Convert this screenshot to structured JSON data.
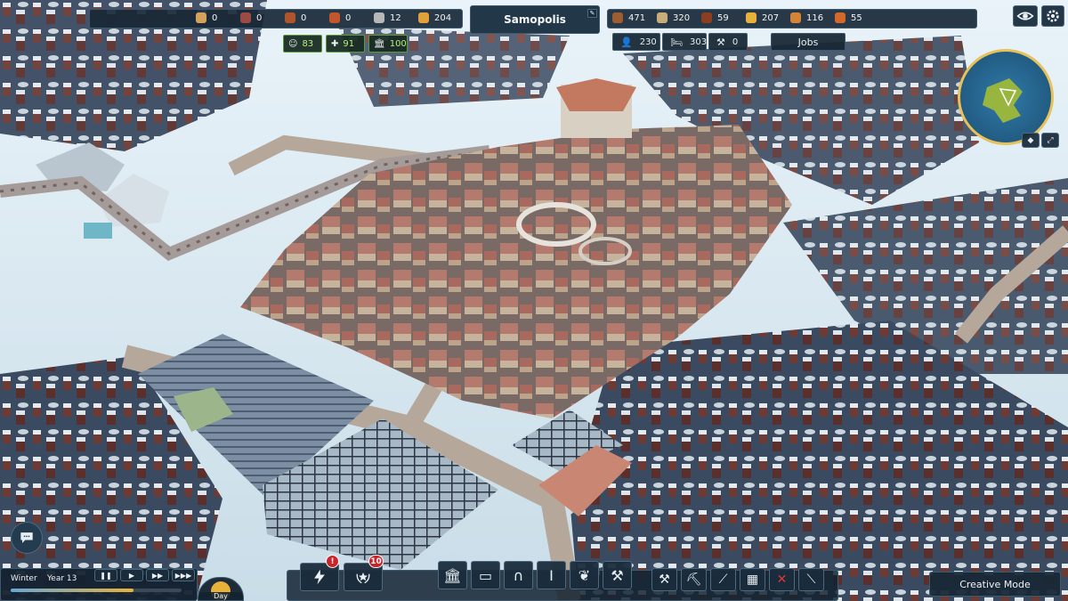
{
  "resources_left": [
    {
      "icon": "amphora-icon",
      "value": "0",
      "color": "#d4a25a"
    },
    {
      "icon": "grapes-icon",
      "value": "0",
      "color": "#9c4a44"
    },
    {
      "icon": "meat-icon",
      "value": "0",
      "color": "#b0542c"
    },
    {
      "icon": "fish-icon",
      "value": "0",
      "color": "#c2572e"
    },
    {
      "icon": "tool-icon",
      "value": "12",
      "color": "#b7b7b7"
    },
    {
      "icon": "bread-icon",
      "value": "204",
      "color": "#e2a03b"
    }
  ],
  "resources_right": [
    {
      "icon": "wood-icon",
      "value": "471",
      "color": "#9b5d31"
    },
    {
      "icon": "stone-icon",
      "value": "320",
      "color": "#c6ad7a"
    },
    {
      "icon": "clay-icon",
      "value": "59",
      "color": "#8a3e22"
    },
    {
      "icon": "gold-icon",
      "value": "207",
      "color": "#e7b23a"
    },
    {
      "icon": "fur-icon",
      "value": "116",
      "color": "#d48436"
    },
    {
      "icon": "wheat-icon",
      "value": "55",
      "color": "#d2692a"
    }
  ],
  "city": {
    "name": "Samopolis",
    "rename_icon": "edit-icon"
  },
  "stats": [
    {
      "icon": "happiness-icon",
      "value": "83"
    },
    {
      "icon": "health-icon",
      "value": "91"
    },
    {
      "icon": "civic-icon",
      "value": "100"
    }
  ],
  "population": {
    "citizens": "230",
    "housing": "303",
    "unemployed": "0",
    "jobs_label": "Jobs"
  },
  "time": {
    "season": "Winter",
    "year": "Year 13",
    "cycle": "Day",
    "year_progress": 0.72
  },
  "notifications": {
    "alert_badge": "!",
    "achievements_badge": "10"
  },
  "build_menu": [
    {
      "icon": "temple-icon",
      "name": "civic"
    },
    {
      "icon": "market-icon",
      "name": "commerce"
    },
    {
      "icon": "arch-icon",
      "name": "infrastructure"
    },
    {
      "icon": "column-icon",
      "name": "monuments"
    },
    {
      "icon": "wheat-icon",
      "name": "farming"
    },
    {
      "icon": "hammer-icon",
      "name": "industry"
    }
  ],
  "tools": [
    {
      "icon": "build-tools-icon"
    },
    {
      "icon": "demolish-icon"
    },
    {
      "icon": "road-icon"
    },
    {
      "icon": "wall-icon"
    },
    {
      "icon": "delete-icon"
    },
    {
      "icon": "pipe-icon"
    }
  ],
  "mode_label": "Creative Mode",
  "colors": {
    "panel": "#182836",
    "accent": "#5d9a3c",
    "alert": "#c7252b",
    "gold": "#e7b23a"
  }
}
